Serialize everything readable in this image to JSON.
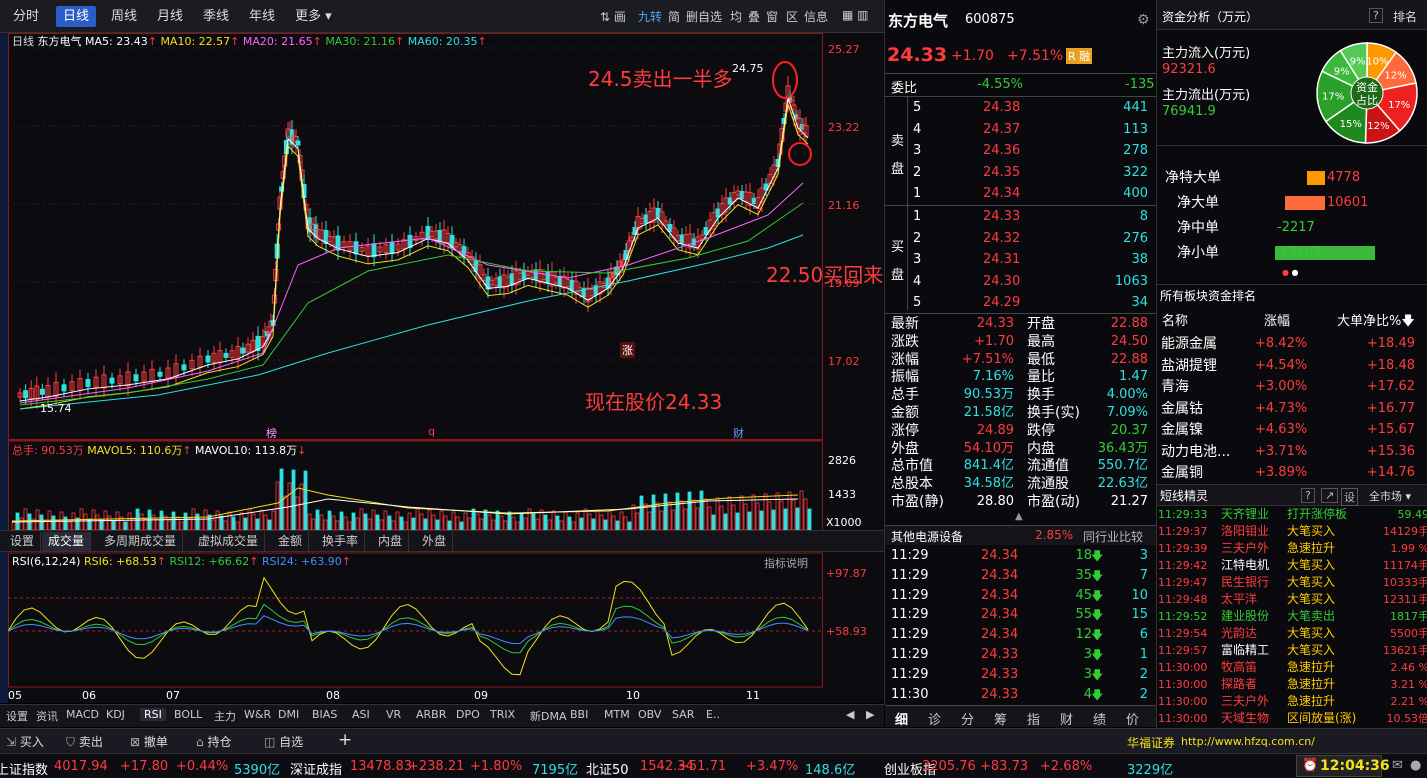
{
  "periods": [
    "分时",
    "日线",
    "周线",
    "月线",
    "季线",
    "年线",
    "更多"
  ],
  "top_tools": [
    "画",
    "九转",
    "简",
    "删自选",
    "均",
    "叠",
    "窗",
    "区",
    "信息"
  ],
  "legend": {
    "prefix": "日线",
    "name": "东方电气",
    "ma5": "MA5: 23.43",
    "ma10": "MA10: 22.57",
    "ma20": "MA20: 21.65",
    "ma30": "MA30: 21.16",
    "ma60": "MA60: 20.35"
  },
  "price_axis": [
    "25.27",
    "23.22",
    "21.16",
    "19.09",
    "17.02"
  ],
  "annot": {
    "sell": "24.5卖出一半多",
    "buy": "22.50买回来",
    "now": "现在股价24.33",
    "hi": "24.75",
    "lo": "15.74",
    "zhang": "涨",
    "bang": "榜",
    "q": "q",
    "cai": "财"
  },
  "vol_legend": {
    "total": "总手: 90.53万",
    "mavol5": "MAVOL5: 110.6万",
    "mavol10": "MAVOL10: 113.8万"
  },
  "vol_axis": [
    "2826",
    "1433",
    "X1000"
  ],
  "sub_tabs": [
    "设置",
    "成交量",
    "多周期成交量",
    "虚拟成交量",
    "金额",
    "换手率",
    "内盘",
    "外盘"
  ],
  "rsi_legend": {
    "name": "RSI(6,12,24)",
    "r6": "RSI6: +68.53",
    "r12": "RSI12: +66.62",
    "r24": "RSI24: +63.90",
    "help": "指标说明"
  },
  "rsi_axis": [
    "+97.87",
    "+58.93"
  ],
  "months": [
    "05",
    "06",
    "07",
    "08",
    "09",
    "10",
    "11"
  ],
  "ind_tabs": [
    "设置",
    "资讯",
    "MACD",
    "KDJ",
    "RSI",
    "BOLL",
    "主力",
    "W&R",
    "DMI",
    "BIAS",
    "ASI",
    "VR",
    "ARBR",
    "DPO",
    "TRIX",
    "新DMA",
    "BBI",
    "MTM",
    "OBV",
    "SAR",
    "E.."
  ],
  "stock": {
    "name": "东方电气",
    "code": "600875",
    "price": "24.33",
    "chg": "+1.70",
    "pct": "+7.51%",
    "r": "R",
    "rong": "融"
  },
  "weibi": {
    "label": "委比",
    "pct": "-4.55%",
    "diff": "-135"
  },
  "sell": [
    [
      "5",
      "24.38",
      "441"
    ],
    [
      "4",
      "24.37",
      "113"
    ],
    [
      "3",
      "24.36",
      "278"
    ],
    [
      "2",
      "24.35",
      "322"
    ],
    [
      "1",
      "24.34",
      "400"
    ]
  ],
  "buy": [
    [
      "1",
      "24.33",
      "8"
    ],
    [
      "2",
      "24.32",
      "276"
    ],
    [
      "3",
      "24.31",
      "38"
    ],
    [
      "4",
      "24.30",
      "1063"
    ],
    [
      "5",
      "24.29",
      "34"
    ]
  ],
  "side_sell": [
    "卖",
    "盘"
  ],
  "side_buy": [
    "买",
    "盘"
  ],
  "quote": [
    [
      "最新",
      "24.33",
      "开盘",
      "22.88"
    ],
    [
      "涨跌",
      "+1.70",
      "最高",
      "24.50"
    ],
    [
      "涨幅",
      "+7.51%",
      "最低",
      "22.88"
    ],
    [
      "振幅",
      "7.16%",
      "量比",
      "1.47"
    ],
    [
      "总手",
      "90.53万",
      "换手",
      "4.00%"
    ],
    [
      "金额",
      "21.58亿",
      "换手(实)",
      "7.09%"
    ],
    [
      "涨停",
      "24.89",
      "跌停",
      "20.37"
    ],
    [
      "外盘",
      "54.10万",
      "内盘",
      "36.43万"
    ],
    [
      "总市值",
      "841.4亿",
      "流通值",
      "550.7亿"
    ],
    [
      "总股本",
      "34.58亿",
      "流通股",
      "22.63亿"
    ],
    [
      "市盈(静)",
      "28.80",
      "市盈(动)",
      "21.27"
    ]
  ],
  "sector": {
    "name": "其他电源设备",
    "pct": "2.85%",
    "cmp": "同行业比较"
  },
  "ticks": [
    [
      "11:29",
      "24.34",
      "18",
      "3"
    ],
    [
      "11:29",
      "24.34",
      "35",
      "7"
    ],
    [
      "11:29",
      "24.34",
      "45",
      "10"
    ],
    [
      "11:29",
      "24.34",
      "55",
      "15"
    ],
    [
      "11:29",
      "24.34",
      "12",
      "6"
    ],
    [
      "11:29",
      "24.33",
      "3",
      "1"
    ],
    [
      "11:29",
      "24.33",
      "3",
      "2"
    ],
    [
      "11:30",
      "24.33",
      "4",
      "2"
    ]
  ],
  "mid_tabs": [
    "细",
    "诊",
    "分",
    "筹",
    "指",
    "财",
    "绩",
    "价"
  ],
  "fund": {
    "title": "资金分析（万元）",
    "help": "?",
    "rank": "排名",
    "in_label": "主力流入(万元)",
    "in_val": "92321.6",
    "out_label": "主力流出(万元)",
    "out_val": "76941.9",
    "pie_center": [
      "资金",
      "占比"
    ],
    "pie": [
      {
        "v": "10%",
        "c": "#ff9900"
      },
      {
        "v": "12%",
        "c": "#ff6a3a"
      },
      {
        "v": "17%",
        "c": "#ee2020"
      },
      {
        "v": "12%",
        "c": "#c81414"
      },
      {
        "v": "15%",
        "c": "#1e8a1e"
      },
      {
        "v": "17%",
        "c": "#2aa02a"
      },
      {
        "v": "9%",
        "c": "#3cb83c"
      },
      {
        "v": "9%",
        "c": "#56c856"
      }
    ],
    "bars": [
      {
        "label": "净特大单",
        "val": "4778",
        "c": "#ff9900"
      },
      {
        "label": "净大单",
        "val": "10601",
        "c": "#ff6a3a"
      },
      {
        "label": "净中单",
        "val": "-2217",
        "c": "#2aa02a"
      },
      {
        "label": "净小单",
        "val": "-13163",
        "c": "#3cb83c"
      }
    ]
  },
  "boards": {
    "title": "所有板块资金排名",
    "h": [
      "名称",
      "涨幅",
      "大单净比%"
    ],
    "rows": [
      [
        "能源金属",
        "+8.42%",
        "+18.49"
      ],
      [
        "盐湖提锂",
        "+4.54%",
        "+18.48"
      ],
      [
        "青海",
        "+3.00%",
        "+17.62"
      ],
      [
        "金属钴",
        "+4.73%",
        "+16.77"
      ],
      [
        "金属镍",
        "+4.63%",
        "+15.67"
      ],
      [
        "动力电池...",
        "+3.71%",
        "+15.36"
      ],
      [
        "金属铜",
        "+3.89%",
        "+14.76"
      ]
    ]
  },
  "sprite": {
    "title": "短线精灵",
    "btns": [
      "?",
      "↗",
      "设",
      "全市场"
    ],
    "rows": [
      [
        "11:29:33",
        "天齐锂业",
        "打开涨停板",
        "59.49",
        "g"
      ],
      [
        "11:29:37",
        "洛阳钼业",
        "大笔买入",
        "14129手",
        "r"
      ],
      [
        "11:29:39",
        "三夫户外",
        "急速拉升",
        "1.99 %",
        "r"
      ],
      [
        "11:29:42",
        "江特电机",
        "大笔买入",
        "11174手",
        "r"
      ],
      [
        "11:29:47",
        "民生银行",
        "大笔买入",
        "10333手",
        "r"
      ],
      [
        "11:29:48",
        "太平洋",
        "大笔买入",
        "12311手",
        "r"
      ],
      [
        "11:29:52",
        "建业股份",
        "大笔卖出",
        "1817手",
        "g"
      ],
      [
        "11:29:54",
        "光韵达",
        "大笔买入",
        "5500手",
        "r"
      ],
      [
        "11:29:57",
        "富临精工",
        "大笔买入",
        "13621手",
        "r"
      ],
      [
        "11:30:00",
        "牧高笛",
        "急速拉升",
        "2.46 %",
        "r"
      ],
      [
        "11:30:00",
        "探路者",
        "急速拉升",
        "3.21 %",
        "r"
      ],
      [
        "11:30:00",
        "三夫户外",
        "急速拉升",
        "2.21 %",
        "r"
      ],
      [
        "11:30:00",
        "天域生物",
        "区间放量(涨)",
        "10.53倍",
        "r"
      ]
    ]
  },
  "actions": [
    "买入",
    "卖出",
    "撤单",
    "持仓",
    "自选",
    "+"
  ],
  "broker": {
    "name": "华福证券",
    "url": "http://www.hfzq.com.cn/"
  },
  "indices": [
    {
      "n": "上证指数",
      "v": "4017.94",
      "c": "+17.80",
      "p": "+0.44%",
      "a": "5390亿"
    },
    {
      "n": "深证成指",
      "v": "13478.83",
      "c": "+238.21",
      "p": "+1.80%",
      "a": "7195亿"
    },
    {
      "n": "北证50",
      "v": "1542.34",
      "c": "+51.71",
      "p": "+3.47%",
      "a": "148.6亿"
    },
    {
      "n": "创业板指",
      "v": "3205.76",
      "c": "+83.73",
      "p": "+2.68%",
      "a": "3229亿"
    }
  ],
  "clock": "12:04:36"
}
